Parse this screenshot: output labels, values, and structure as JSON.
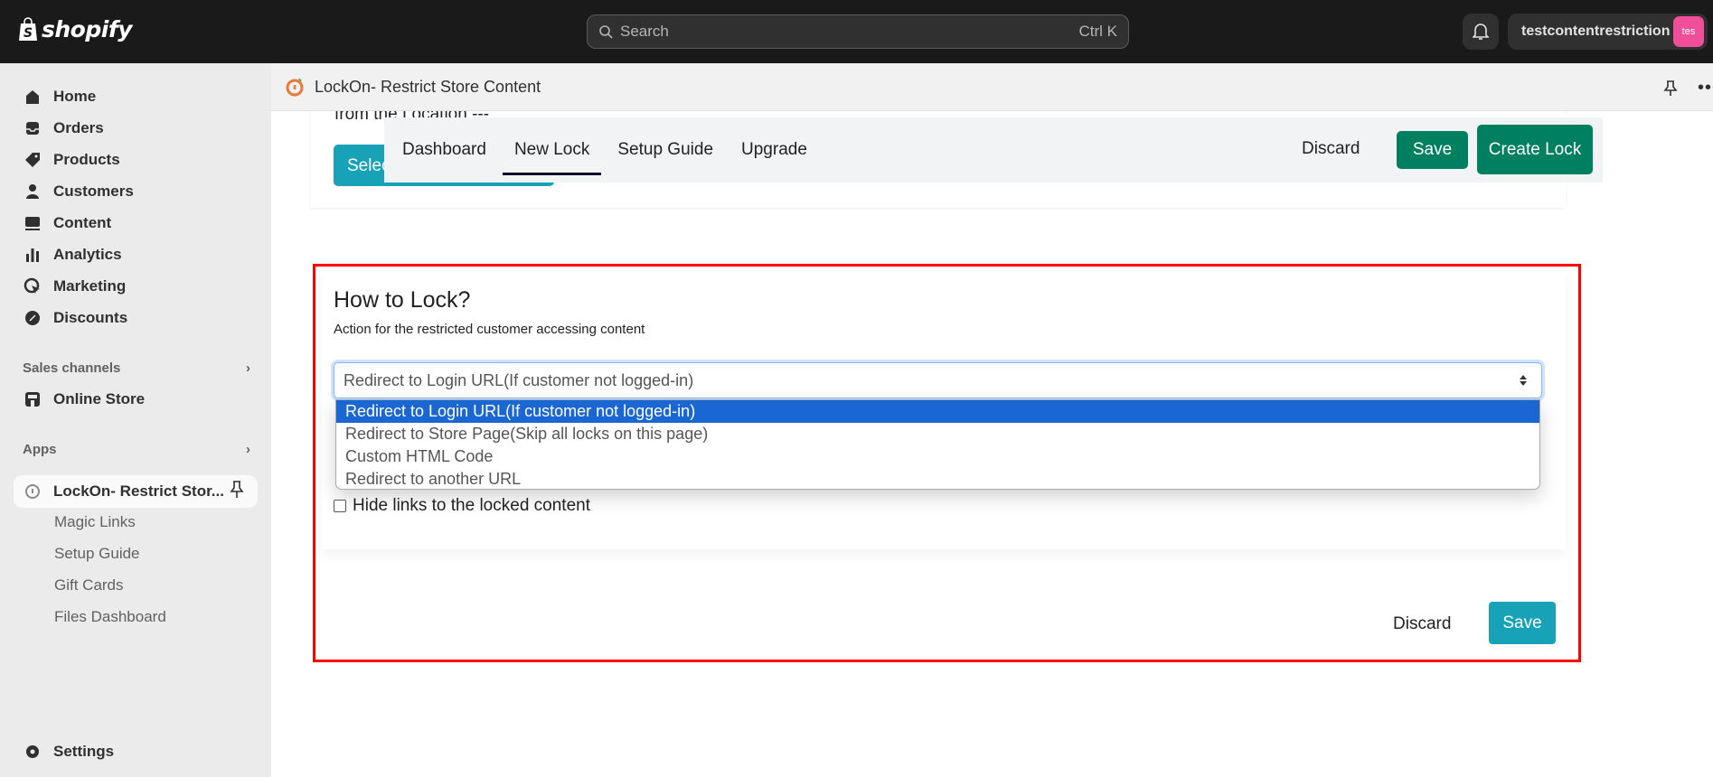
{
  "topbar": {
    "logo_text": "shopify",
    "search_placeholder": "Search",
    "search_shortcut": "Ctrl K",
    "account_name": "testcontentrestriction",
    "avatar_initials": "tes",
    "avatar_color": "#f04e98"
  },
  "sidebar": {
    "items": [
      {
        "label": "Home",
        "icon": "home-icon"
      },
      {
        "label": "Orders",
        "icon": "inbox-icon"
      },
      {
        "label": "Products",
        "icon": "tag-icon"
      },
      {
        "label": "Customers",
        "icon": "person-icon"
      },
      {
        "label": "Content",
        "icon": "image-icon"
      },
      {
        "label": "Analytics",
        "icon": "bar-chart-icon"
      },
      {
        "label": "Marketing",
        "icon": "target-icon"
      },
      {
        "label": "Discounts",
        "icon": "discount-icon"
      }
    ],
    "sales_channels": "Sales channels",
    "online_store": "Online Store",
    "apps": "Apps",
    "app_name": "LockOn- Restrict Stor...",
    "app_subitems": [
      "Magic Links",
      "Setup Guide",
      "Gift Cards",
      "Files Dashboard"
    ],
    "settings": "Settings"
  },
  "app_header": {
    "title": "LockOn- Restrict Store Content"
  },
  "partial": {
    "location_text": "from the Location ---",
    "select_button": "Select"
  },
  "tabs": {
    "items": [
      "Dashboard",
      "New Lock",
      "Setup Guide",
      "Upgrade"
    ],
    "active": "New Lock",
    "discard": "Discard",
    "save": "Save",
    "create_lock": "Create Lock",
    "accent": "#008060"
  },
  "lock_card": {
    "title": "How to Lock?",
    "description": "Action for the restricted customer accessing content",
    "select_value": "Redirect to Login URL(If customer not logged-in)",
    "options": [
      "Redirect to Login URL(If customer not logged-in)",
      "Redirect to Store Page(Skip all locks on this page)",
      "Custom HTML Code",
      "Redirect to another URL"
    ],
    "selected_index": 0,
    "checkbox_label": "Hide links to the locked content",
    "checkbox_checked": false,
    "discard": "Discard",
    "save": "Save",
    "save_color": "#18a2b8",
    "highlight_color": "#ff0000"
  }
}
